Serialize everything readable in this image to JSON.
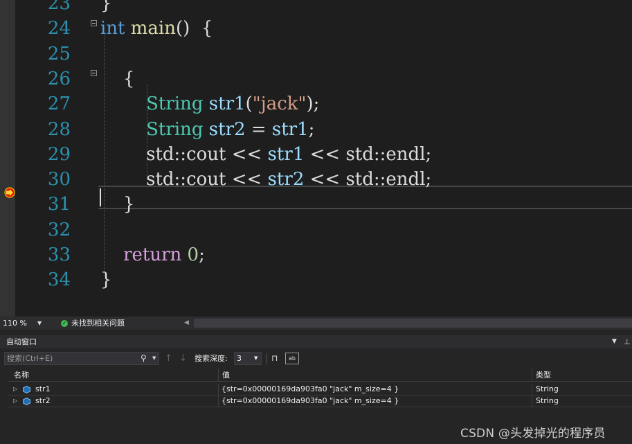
{
  "editor": {
    "lines": [
      {
        "number": "23",
        "tokens": [
          {
            "text": "}",
            "cls": "tok-punct"
          }
        ]
      },
      {
        "number": "24",
        "tokens": [
          {
            "text": "int",
            "cls": "tok-keyword"
          },
          {
            "text": " ",
            "cls": "tok-punct"
          },
          {
            "text": "main",
            "cls": "tok-func"
          },
          {
            "text": "()  {",
            "cls": "tok-punct"
          }
        ]
      },
      {
        "number": "25",
        "tokens": []
      },
      {
        "number": "26",
        "tokens": [
          {
            "text": "    {",
            "cls": "tok-punct"
          }
        ]
      },
      {
        "number": "27",
        "tokens": [
          {
            "text": "        ",
            "cls": "tok-punct"
          },
          {
            "text": "String",
            "cls": "tok-type"
          },
          {
            "text": " ",
            "cls": "tok-punct"
          },
          {
            "text": "str1",
            "cls": "tok-var"
          },
          {
            "text": "(",
            "cls": "tok-punct"
          },
          {
            "text": "\"jack\"",
            "cls": "tok-string"
          },
          {
            "text": ");",
            "cls": "tok-punct"
          }
        ]
      },
      {
        "number": "28",
        "tokens": [
          {
            "text": "        ",
            "cls": "tok-punct"
          },
          {
            "text": "String",
            "cls": "tok-type"
          },
          {
            "text": " ",
            "cls": "tok-punct"
          },
          {
            "text": "str2",
            "cls": "tok-var"
          },
          {
            "text": " = ",
            "cls": "tok-punct"
          },
          {
            "text": "str1",
            "cls": "tok-var"
          },
          {
            "text": ";",
            "cls": "tok-punct"
          }
        ]
      },
      {
        "number": "29",
        "tokens": [
          {
            "text": "        std::cout << ",
            "cls": "tok-punct"
          },
          {
            "text": "str1",
            "cls": "tok-var"
          },
          {
            "text": " << std::endl;",
            "cls": "tok-punct"
          }
        ]
      },
      {
        "number": "30",
        "tokens": [
          {
            "text": "        std::cout << ",
            "cls": "tok-punct"
          },
          {
            "text": "str2",
            "cls": "tok-var"
          },
          {
            "text": " << std::endl;",
            "cls": "tok-punct"
          }
        ]
      },
      {
        "number": "31",
        "tokens": [
          {
            "text": "    }",
            "cls": "tok-punct"
          }
        ]
      },
      {
        "number": "32",
        "tokens": []
      },
      {
        "number": "33",
        "tokens": [
          {
            "text": "    ",
            "cls": "tok-punct"
          },
          {
            "text": "return",
            "cls": "tok-control"
          },
          {
            "text": " ",
            "cls": "tok-punct"
          },
          {
            "text": "0",
            "cls": "tok-number"
          },
          {
            "text": ";",
            "cls": "tok-punct"
          }
        ]
      },
      {
        "number": "34",
        "tokens": [
          {
            "text": "}",
            "cls": "tok-punct"
          }
        ]
      }
    ]
  },
  "status": {
    "zoom": "110 %",
    "issues_text": "未找到相关问题"
  },
  "autos": {
    "title": "自动窗口",
    "search_placeholder": "搜索(Ctrl+E)",
    "depth_label": "搜索深度:",
    "depth_value": "3",
    "columns": {
      "name": "名称",
      "value": "值",
      "type": "类型"
    },
    "rows": [
      {
        "name": "str1",
        "value": "{str=0x00000169da903fa0 \"jack\" m_size=4 }",
        "type": "String"
      },
      {
        "name": "str2",
        "value": "{str=0x00000169da903fa0 \"jack\" m_size=4 }",
        "type": "String"
      }
    ]
  },
  "watermark": "CSDN @头发掉光的程序员",
  "colors": {
    "background": "#1e1e1e",
    "line_number": "#2b91af",
    "keyword": "#569cd6",
    "type": "#4ec9b0"
  }
}
